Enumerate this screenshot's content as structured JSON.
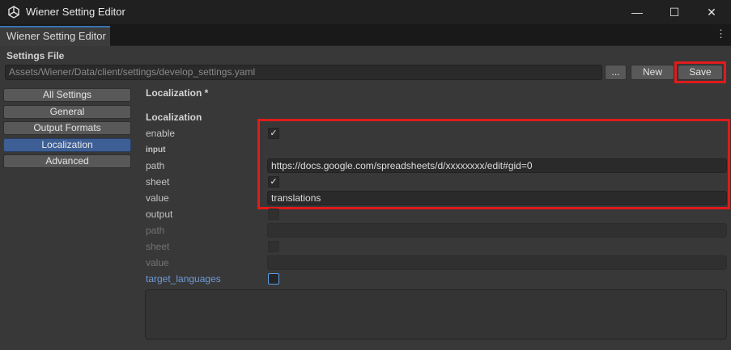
{
  "window": {
    "title": "Wiener Setting Editor",
    "minimize_glyph": "—",
    "maximize_glyph": "☐",
    "close_glyph": "✕"
  },
  "tab": {
    "label": "Wiener Setting Editor",
    "menu_glyph": "⋮"
  },
  "settings_file": {
    "label": "Settings File",
    "path": "Assets/Wiener/Data/client/settings/develop_settings.yaml",
    "browse_label": "...",
    "new_label": "New",
    "save_label": "Save"
  },
  "nav": {
    "items": [
      {
        "label": "All Settings",
        "selected": false
      },
      {
        "label": "General",
        "selected": false
      },
      {
        "label": "Output Formats",
        "selected": false
      },
      {
        "label": "Localization",
        "selected": true
      },
      {
        "label": "Advanced",
        "selected": false
      }
    ]
  },
  "content": {
    "page_title": "Localization *",
    "section_title": "Localization",
    "enable_label": "enable",
    "enable_checked": true,
    "input_label": "input",
    "input_path_label": "path",
    "input_path_value": "https://docs.google.com/spreadsheets/d/xxxxxxxx/edit#gid=0",
    "input_sheet_label": "sheet",
    "input_sheet_checked": true,
    "input_value_label": "value",
    "input_value_value": "translations",
    "output_label": "output",
    "output_path_label": "path",
    "output_sheet_label": "sheet",
    "output_value_label": "value",
    "target_languages_label": "target_languages",
    "check_glyph": "✓"
  },
  "colors": {
    "accent": "#3e5f96",
    "highlight": "#e01b1b",
    "link": "#6e9ad8"
  }
}
